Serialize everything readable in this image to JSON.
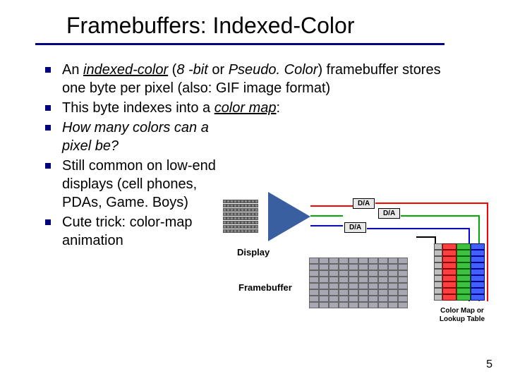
{
  "slide": {
    "title": "Framebuffers: Indexed-Color",
    "bullets": [
      {
        "pre": "An ",
        "em1": "indexed-color",
        "mid1": " (",
        "em2": "8 -bit",
        "mid2": " or ",
        "em3": "Pseudo. Color",
        "mid3": ") framebuffer stores one byte per pixel (also: GIF image format)"
      },
      {
        "pre": "This byte indexes into a ",
        "em1": "color map",
        "post": ":"
      },
      {
        "em1": "How many colors can a pixel be?"
      },
      {
        "plain": "Still common on low-end displays (cell phones, PDAs, Game. Boys)"
      },
      {
        "plain": "Cute trick: color-map animation"
      }
    ],
    "diagram": {
      "da1": "D/A",
      "da2": "D/A",
      "da3": "D/A",
      "display_label": "Display",
      "framebuffer_label": "Framebuffer",
      "colormap_label": "Color Map or Lookup Table"
    },
    "page_number": "5"
  }
}
